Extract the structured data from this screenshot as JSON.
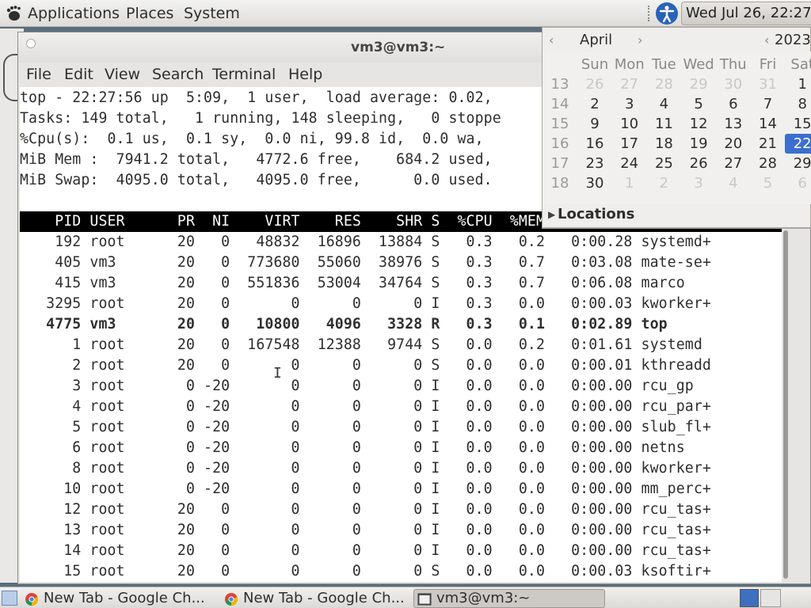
{
  "top_panel": {
    "menus": [
      "Applications",
      "Places",
      "System"
    ],
    "clock": "Wed Jul 26, 22:27"
  },
  "terminal": {
    "title": "vm3@vm3:~",
    "menus": [
      "File",
      "Edit",
      "View",
      "Search",
      "Terminal",
      "Help"
    ],
    "summary": [
      "top - 22:27:56 up  5:09,  1 user,  load average: 0.02,",
      "Tasks: 149 total,   1 running, 148 sleeping,   0 stoppe",
      "%Cpu(s):  0.1 us,  0.1 sy,  0.0 ni, 99.8 id,  0.0 wa,",
      "MiB Mem :  7941.2 total,   4772.6 free,    684.2 used,",
      "MiB Swap:  4095.0 total,   4095.0 free,      0.0 used."
    ],
    "header": "    PID USER      PR  NI    VIRT    RES    SHR S  %CPU  %MEM     TIME+ COMMAND",
    "processes": [
      "    192 root      20   0   48832  16896  13884 S   0.3   0.2   0:00.28 systemd+",
      "    405 vm3       20   0  773680  55060  38976 S   0.3   0.7   0:03.08 mate-se+",
      "    415 vm3       20   0  551836  53004  34764 S   0.3   0.7   0:06.08 marco",
      "   3295 root      20   0       0      0      0 I   0.3   0.0   0:00.03 kworker+",
      "   4775 vm3       20   0   10800   4096   3328 R   0.3   0.1   0:02.89 top",
      "      1 root      20   0  167548  12388   9744 S   0.0   0.2   0:01.61 systemd",
      "      2 root      20   0       0      0      0 S   0.0   0.0   0:00.01 kthreadd",
      "      3 root       0 -20       0      0      0 I   0.0   0.0   0:00.00 rcu_gp",
      "      4 root       0 -20       0      0      0 I   0.0   0.0   0:00.00 rcu_par+",
      "      5 root       0 -20       0      0      0 I   0.0   0.0   0:00.00 slub_fl+",
      "      6 root       0 -20       0      0      0 I   0.0   0.0   0:00.00 netns",
      "      8 root       0 -20       0      0      0 I   0.0   0.0   0:00.00 kworker+",
      "     10 root       0 -20       0      0      0 I   0.0   0.0   0:00.00 mm_perc+",
      "     12 root      20   0       0      0      0 I   0.0   0.0   0:00.00 rcu_tas+",
      "     13 root      20   0       0      0      0 I   0.0   0.0   0:00.00 rcu_tas+",
      "     14 root      20   0       0      0      0 I   0.0   0.0   0:00.00 rcu_tas+",
      "     15 root      20   0       0      0      0 S   0.0   0.0   0:00.03 ksoftir+"
    ],
    "bold_row_index": 4
  },
  "calendar": {
    "month": "April",
    "year": "2023",
    "weekdays": [
      "Sun",
      "Mon",
      "Tue",
      "Wed",
      "Thu",
      "Fri",
      "Sat"
    ],
    "weeks": [
      {
        "week": "13",
        "days": [
          "26",
          "27",
          "28",
          "29",
          "30",
          "31",
          "1"
        ],
        "dim": [
          true,
          true,
          true,
          true,
          true,
          true,
          false
        ]
      },
      {
        "week": "14",
        "days": [
          "2",
          "3",
          "4",
          "5",
          "6",
          "7",
          "8"
        ],
        "dim": [
          false,
          false,
          false,
          false,
          false,
          false,
          false
        ]
      },
      {
        "week": "15",
        "days": [
          "9",
          "10",
          "11",
          "12",
          "13",
          "14",
          "15"
        ],
        "dim": [
          false,
          false,
          false,
          false,
          false,
          false,
          false
        ]
      },
      {
        "week": "16",
        "days": [
          "16",
          "17",
          "18",
          "19",
          "20",
          "21",
          "22"
        ],
        "dim": [
          false,
          false,
          false,
          false,
          false,
          false,
          false
        ]
      },
      {
        "week": "17",
        "days": [
          "23",
          "24",
          "25",
          "26",
          "27",
          "28",
          "29"
        ],
        "dim": [
          false,
          false,
          false,
          false,
          false,
          false,
          false
        ]
      },
      {
        "week": "18",
        "days": [
          "30",
          "1",
          "2",
          "3",
          "4",
          "5",
          "6"
        ],
        "dim": [
          false,
          true,
          true,
          true,
          true,
          true,
          true
        ]
      }
    ],
    "selected_day": "22",
    "locations_label": "Locations"
  },
  "taskbar": {
    "tasks": [
      {
        "label": "New Tab - Google Ch...",
        "icon": "chrome-icon",
        "active": false
      },
      {
        "label": "New Tab - Google Ch...",
        "icon": "chrome-icon",
        "active": false
      },
      {
        "label": "vm3@vm3:~",
        "icon": "terminal-icon",
        "active": true
      }
    ]
  },
  "colors": {
    "accent": "#3c6fcf",
    "terminal_bg": "#ffffff",
    "header_bg": "#000000",
    "panel_bg": "#e6e5e3"
  }
}
